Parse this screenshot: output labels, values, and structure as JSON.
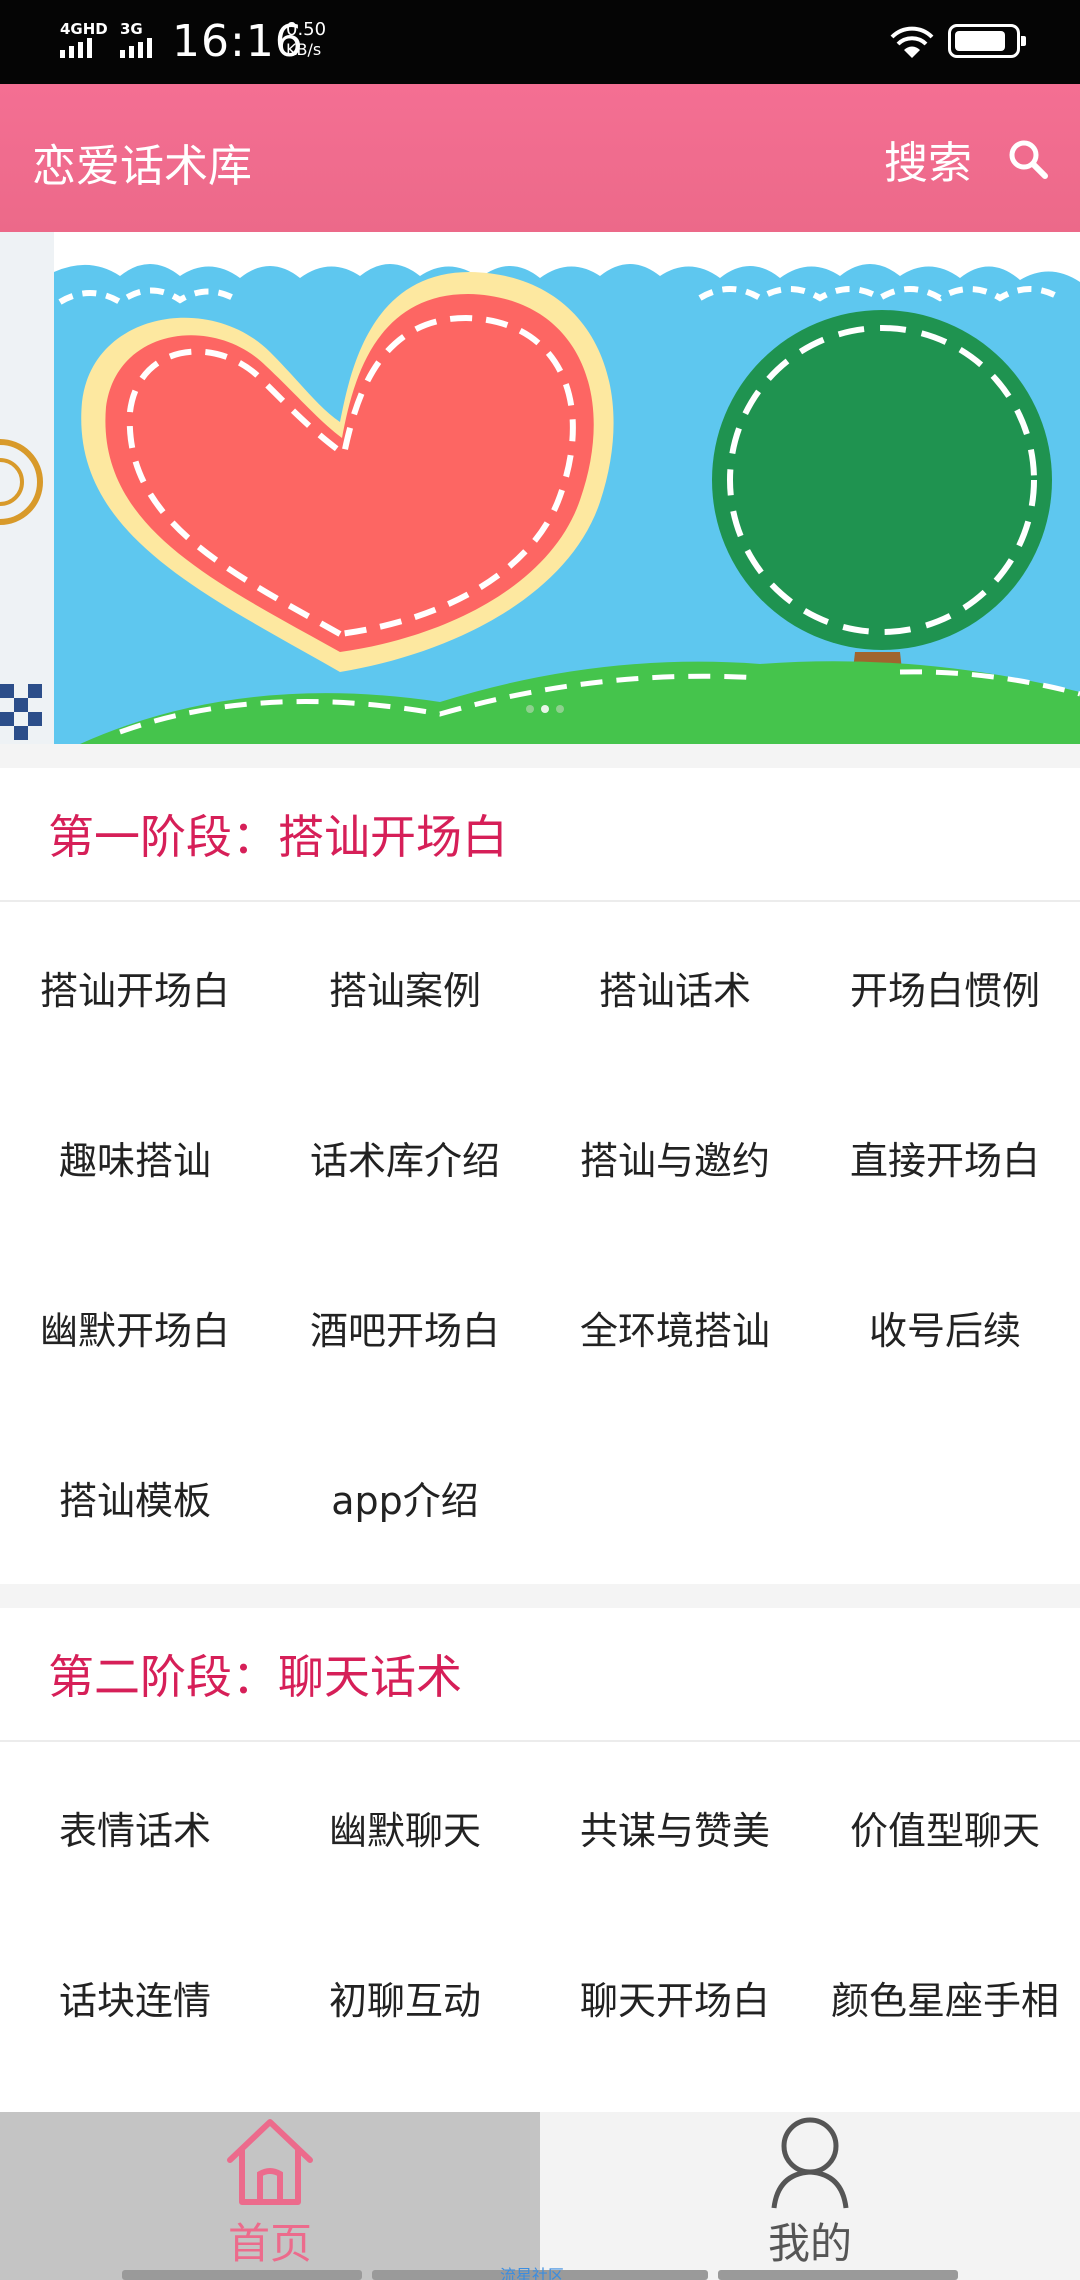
{
  "status_bar": {
    "network_1": "4GHD",
    "network_2": "3G",
    "time": "16:16",
    "speed_value": "0.50",
    "speed_unit": "KB/s",
    "wifi_icon": "wifi-icon",
    "battery_icon": "battery-icon"
  },
  "app_bar": {
    "title": "恋爱话术库",
    "search_label": "搜索",
    "search_icon": "search-icon"
  },
  "banner": {
    "page_count": 3,
    "active_page": 1
  },
  "sections": [
    {
      "title": "第一阶段：搭讪开场白",
      "items": [
        "搭讪开场白",
        "搭讪案例",
        "搭讪话术",
        "开场白惯例",
        "趣味搭讪",
        "话术库介绍",
        "搭讪与邀约",
        "直接开场白",
        "幽默开场白",
        "酒吧开场白",
        "全环境搭讪",
        "收号后续",
        "搭讪模板",
        "app介绍"
      ]
    },
    {
      "title": "第二阶段：聊天话术",
      "items": [
        "表情话术",
        "幽默聊天",
        "共谋与赞美",
        "价值型聊天",
        "话块连情",
        "初聊互动",
        "聊天开场白",
        "颜色星座手相"
      ]
    }
  ],
  "bottom_nav": {
    "tabs": [
      {
        "label": "首页",
        "icon": "home-icon",
        "active": true
      },
      {
        "label": "我的",
        "icon": "user-icon",
        "active": false
      }
    ]
  },
  "watermark": "流星社区",
  "colors": {
    "accent": "#ec6b8c",
    "section_title": "#d61f58",
    "app_bar": "#f06d8f"
  }
}
